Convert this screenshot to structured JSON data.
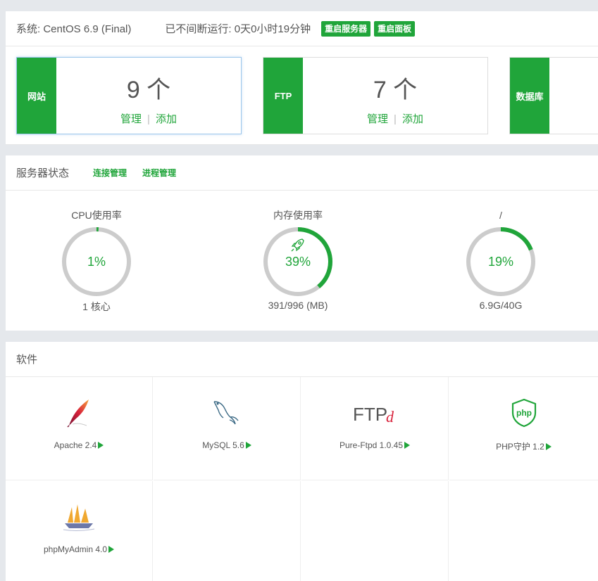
{
  "system": {
    "os_label": "系统: CentOS 6.9 (Final)",
    "uptime_label": "已不间断运行: 0天0小时19分钟",
    "restart_server": "重启服务器",
    "restart_panel": "重启面板"
  },
  "cards": [
    {
      "tag": "网站",
      "count": "9 个",
      "manage": "管理",
      "add": "添加"
    },
    {
      "tag": "FTP",
      "count": "7 个",
      "manage": "管理",
      "add": "添加"
    },
    {
      "tag": "数据库"
    }
  ],
  "link_separator": "|",
  "status": {
    "title": "服务器状态",
    "link_connections": "连接管理",
    "link_processes": "进程管理",
    "gauges": [
      {
        "title": "CPU使用率",
        "value": "1%",
        "percent": 1,
        "sub": "1 核心"
      },
      {
        "title": "内存使用率",
        "value": "39%",
        "percent": 39,
        "sub": "391/996 (MB)",
        "icon": "rocket-icon"
      },
      {
        "title": "/",
        "value": "19%",
        "percent": 19,
        "sub": "6.9G/40G"
      }
    ]
  },
  "software": {
    "title": "软件",
    "items": [
      {
        "name": "Apache 2.4",
        "icon": "apache-feather-icon"
      },
      {
        "name": "MySQL 5.6",
        "icon": "mysql-dolphin-icon"
      },
      {
        "name": "Pure-Ftpd 1.0.45",
        "icon": "ftpd-logo-icon",
        "logo_text": "FTP",
        "logo_letter": "d"
      },
      {
        "name": "PHP守护 1.2",
        "icon": "php-shield-icon",
        "logo_text": "php"
      },
      {
        "name": "phpMyAdmin 4.0",
        "icon": "phpmyadmin-sailboat-icon"
      }
    ]
  },
  "colors": {
    "accent": "#20a53a",
    "gauge_track": "#cccccc",
    "page_bg": "#e5e8ec"
  }
}
